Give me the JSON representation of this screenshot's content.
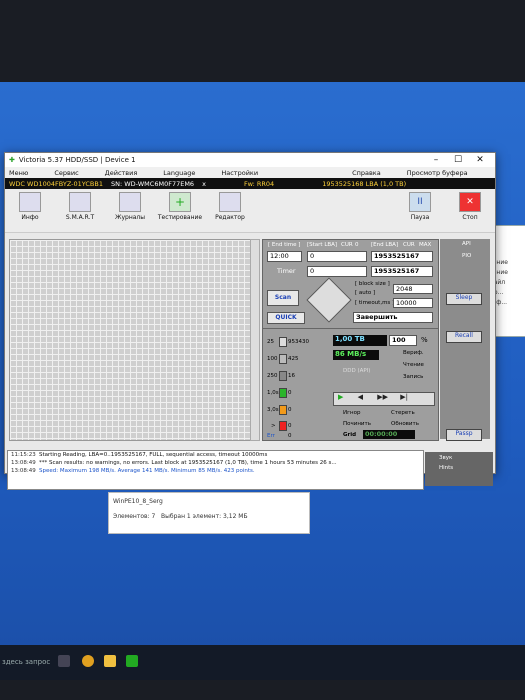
{
  "window": {
    "title": "Victoria 5.37 HDD/SSD | Device 1",
    "controls": [
      "–",
      "☐",
      "✕"
    ]
  },
  "menu": [
    "Меню",
    "Сервис",
    "Действия",
    "Language",
    "Настройки",
    "Справка",
    "Просмотр буфера"
  ],
  "device": {
    "model": "WDC WD1004FBYZ-01YCBB1",
    "sn": "SN: WD-WMC6M0F77EM6",
    "close": "x",
    "fw": "Fw: RR04",
    "lba": "1953525168 LBA (1,0 TB)"
  },
  "toolbar": {
    "info": "Инфо",
    "smart": "S.M.A.R.T",
    "logs": "Журналы",
    "testing": "Тестирование",
    "editor": "Редактор",
    "pause": "Пауза",
    "stop": "Стоп"
  },
  "scan": {
    "end_time_label": "[ End time ]",
    "start_lba_label": "[Start LBA]",
    "cur_label": "CUR",
    "zero_label": "0",
    "end_lba_label": "[End LBA]",
    "cur2_label": "CUR",
    "max_label": "MAX",
    "time_value": "12:00",
    "start_lba_value": "0",
    "end_lba_value": "1953525167",
    "end_lba_value2": "1953525167",
    "timer_label": "Timer",
    "timer_value": "0",
    "block_size_label": "[ block size ]",
    "auto_label": "[ auto ]",
    "block_size_value": "2048",
    "timeout_label": "[ timeout,ms ]",
    "timeout_value": "10000",
    "scan_btn": "Scan",
    "quick_btn": "QUICK",
    "finish_value": "Завершить"
  },
  "stats": {
    "r25": "25",
    "r25v": "953430",
    "r100": "100",
    "r100v": "425",
    "r250": "250",
    "r250v": "16",
    "r1s": "1,0s",
    "r1sv": "0",
    "r3s": "3,0s",
    "r3sv": "0",
    "rgt": ">",
    "rgtv": "0",
    "err": "Err",
    "errv": "0",
    "size": "1,00 TB",
    "percent": "100",
    "pct": "%",
    "speed": "86 MB/s",
    "ddd": "DDD (API)",
    "verify": "Вериф.",
    "read": "Чтение",
    "write": "Запись",
    "ignore": "Игнор",
    "erase": "Стереть",
    "repair": "Починить",
    "refresh": "Обновить",
    "grid": "Grid",
    "clock": "00:00:00"
  },
  "rightcol": {
    "api": "API",
    "pio": "PIO",
    "sleep": "Sleep",
    "recall": "Recall",
    "passp": "Passp"
  },
  "log": [
    {
      "time": "11:15:23",
      "text": "Starting Reading, LBA=0..1953525167, FULL, sequential access, timeout 10000ms"
    },
    {
      "time": "13:08:49",
      "text": "*** Scan results: no warnings, no errors. Last block at 1953525167 (1,0 TB), time 1 hours 53 minutes 26 s..."
    },
    {
      "time": "13:08:49",
      "text": "Speed: Maximum 198 MB/s. Average 141 MB/s. Minimum 85 MB/s. 423 points."
    }
  ],
  "side": {
    "sound": "Звук",
    "hints": "Hints"
  },
  "bg": {
    "item1": "WinPE10_8_Serg",
    "status_items": "Элементов: 7",
    "status_sel": "Выбран 1 элемент: 3,12 МБ",
    "r1": "илание",
    "r2": "илание",
    "r3": "i файл",
    "r4": "фор...",
    "r5": "конф...",
    "search": "здесь запрос"
  }
}
